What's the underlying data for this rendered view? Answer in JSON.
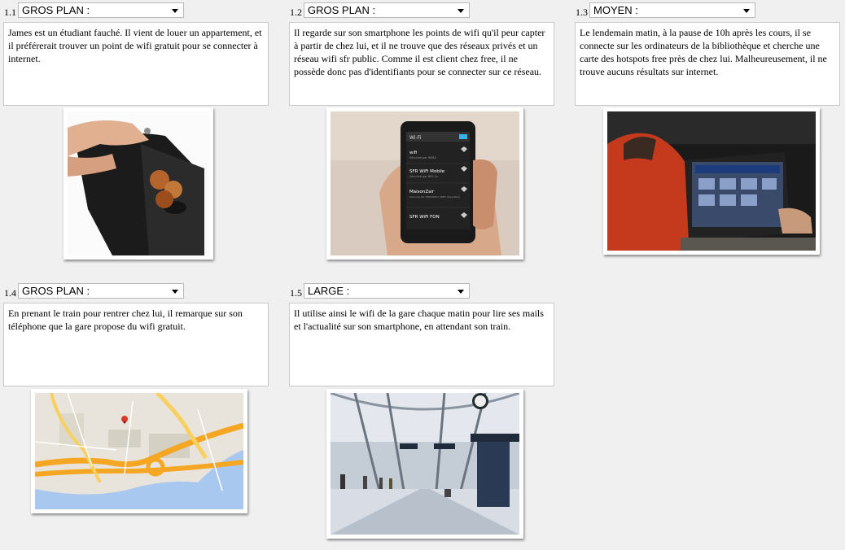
{
  "panels": [
    {
      "number": "1.1",
      "shot": "GROS PLAN :",
      "text": "James est un étudiant fauché. Il vient de louer un appartement, et il préférerait trouver un point de wifi gratuit pour se connecter à internet.",
      "image_icon": "empty-wallet-photo"
    },
    {
      "number": "1.2",
      "shot": "GROS PLAN :",
      "text": "Il regarde sur son smartphone les points de wifi qu'il peur capter à partir de chez lui, et il ne trouve que des réseaux privés et un réseau wifi sfr public. Comme il est client chez free, il ne possède donc pas d'identifiants pour se connecter sur ce réseau.",
      "image_icon": "smartphone-wifi-photo",
      "phone": {
        "header": "Wi-Fi",
        "networks": [
          {
            "name": "wifi",
            "sub": "Sécurisé par WPA2"
          },
          {
            "name": "SFR WiFi Mobile",
            "sub": "Sécurisé par 802.1x"
          },
          {
            "name": "MaisonZair",
            "sub": "Sécurisé par WPA/WPA2 (WPS disponible)"
          },
          {
            "name": "SFR WiFi FON",
            "sub": ""
          }
        ]
      }
    },
    {
      "number": "1.3",
      "shot": "MOYEN :",
      "text": "Le lendemain matin, à la pause de 10h après les cours, il se connecte sur les ordinateurs de la bibliothèque et cherche une carte des hotspots free près de chez lui. Malheureusement, il ne trouve aucuns résultats sur internet.",
      "image_icon": "library-laptop-photo"
    },
    {
      "number": "1.4",
      "shot": "GROS PLAN :",
      "text": "En prenant le train pour rentrer chez lui, il remarque sur son téléphone que la gare propose du wifi gratuit.",
      "image_icon": "station-map-photo"
    },
    {
      "number": "1.5",
      "shot": "LARGE :",
      "text": "Il utilise ainsi le wifi de la gare chaque matin pour lire ses mails et l'actualité sur son smartphone, en attendant son train.",
      "image_icon": "train-station-photo"
    }
  ],
  "colors": {
    "background": "#f0f0f0",
    "map_road": "#f5a623",
    "map_water": "#a8c8f0",
    "map_land": "#e8e4dc"
  }
}
